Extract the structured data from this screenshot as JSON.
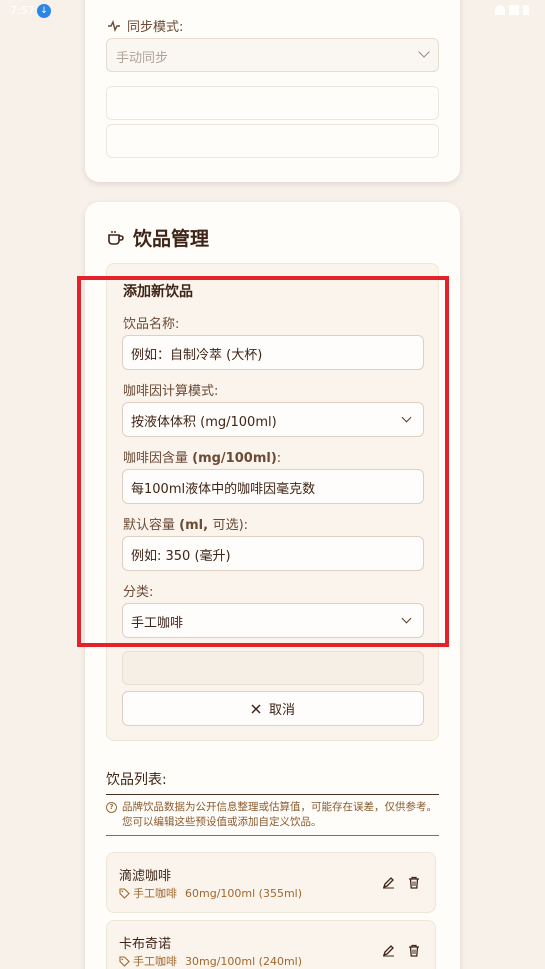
{
  "status_bar": {
    "time": "7:57"
  },
  "sync": {
    "label": "同步模式:",
    "value": "手动同步"
  },
  "drinks_section": {
    "title": "饮品管理",
    "form": {
      "heading": "添加新饮品",
      "name_label": "饮品名称:",
      "name_placeholder": "例如：自制冷萃 (大杯)",
      "mode_label": "咖啡因计算模式:",
      "mode_value": "按液体体积 (mg/100ml)",
      "caffeine_label_prefix": "咖啡因含量 ",
      "caffeine_label_unit": "(mg/100ml)",
      "caffeine_label_suffix": ":",
      "caffeine_placeholder": "每100ml液体中的咖啡因毫克数",
      "volume_label_prefix": "默认容量 ",
      "volume_label_unit": "(ml, ",
      "volume_label_suffix": "可选):",
      "volume_placeholder": "例如: 350 (毫升)",
      "category_label": "分类:",
      "category_value": "手工咖啡",
      "cancel_label": "取消"
    },
    "list": {
      "label": "饮品列表:",
      "note": "品牌饮品数据为公开信息整理或估算值，可能存在误差，仅供参考。您可以编辑这些预设值或添加自定义饮品。",
      "items": [
        {
          "name": "滴滤咖啡",
          "category": "手工咖啡",
          "detail": "60mg/100ml (355ml)"
        },
        {
          "name": "卡布奇诺",
          "category": "手工咖啡",
          "detail": "30mg/100ml (240ml)"
        }
      ]
    }
  },
  "colors": {
    "accent_brown": "#4a2e1f",
    "note_brown": "#a0682e",
    "highlight_red": "#e3222a",
    "background": "#f7f1ea"
  },
  "icons": [
    "download-icon",
    "activity-icon",
    "cup-icon",
    "chevron-down-icon",
    "x-icon",
    "help-circle-icon",
    "tag-icon",
    "edit-icon",
    "trash-icon"
  ]
}
